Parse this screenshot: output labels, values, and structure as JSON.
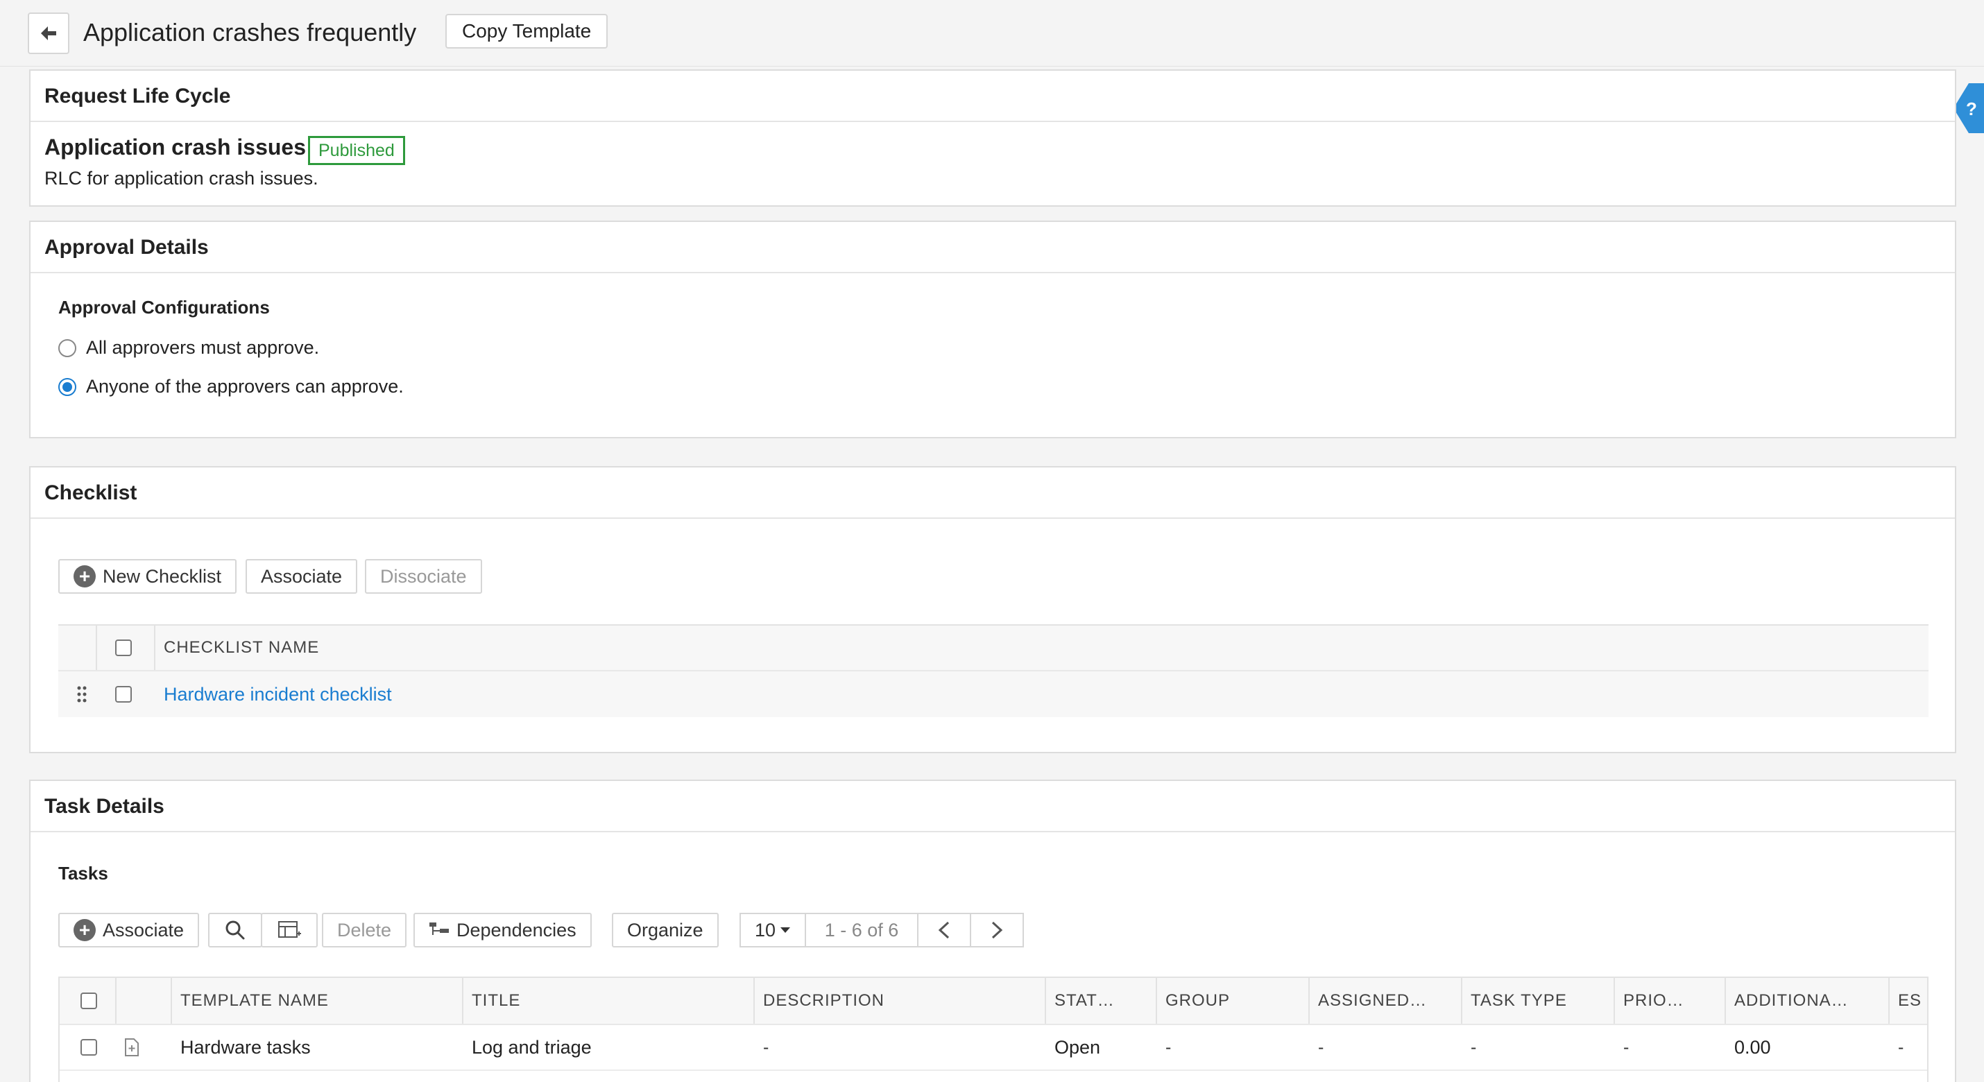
{
  "header": {
    "title": "Application crashes frequently",
    "copy_template_label": "Copy Template",
    "help_label": "?"
  },
  "rlc": {
    "section_title": "Request Life Cycle",
    "name": "Application crash issues",
    "status": "Published",
    "description": "RLC for application crash issues."
  },
  "approval": {
    "section_title": "Approval Details",
    "config_title": "Approval Configurations",
    "options": [
      {
        "label": "All approvers must approve.",
        "selected": false
      },
      {
        "label": "Anyone of the approvers can approve.",
        "selected": true
      }
    ]
  },
  "checklist": {
    "section_title": "Checklist",
    "new_label": "New Checklist",
    "associate_label": "Associate",
    "dissociate_label": "Dissociate",
    "column_header": "CHECKLIST NAME",
    "rows": [
      {
        "name": "Hardware incident checklist"
      }
    ]
  },
  "tasks": {
    "section_title": "Task Details",
    "label": "Tasks",
    "toolbar": {
      "associate_label": "Associate",
      "delete_label": "Delete",
      "dependencies_label": "Dependencies",
      "organize_label": "Organize",
      "page_size": "10",
      "range_text": "1 - 6 of 6"
    },
    "columns": [
      "TEMPLATE NAME",
      "TITLE",
      "DESCRIPTION",
      "STAT…",
      "GROUP",
      "ASSIGNED…",
      "TASK TYPE",
      "PRIO…",
      "ADDITIONA…",
      "ES"
    ],
    "rows": [
      {
        "template_name": "Hardware tasks",
        "title": "Log and triage",
        "description": "-",
        "status": "Open",
        "group": "-",
        "assigned": "-",
        "task_type": "-",
        "priority": "-",
        "additional": "0.00",
        "est": "-"
      }
    ]
  }
}
